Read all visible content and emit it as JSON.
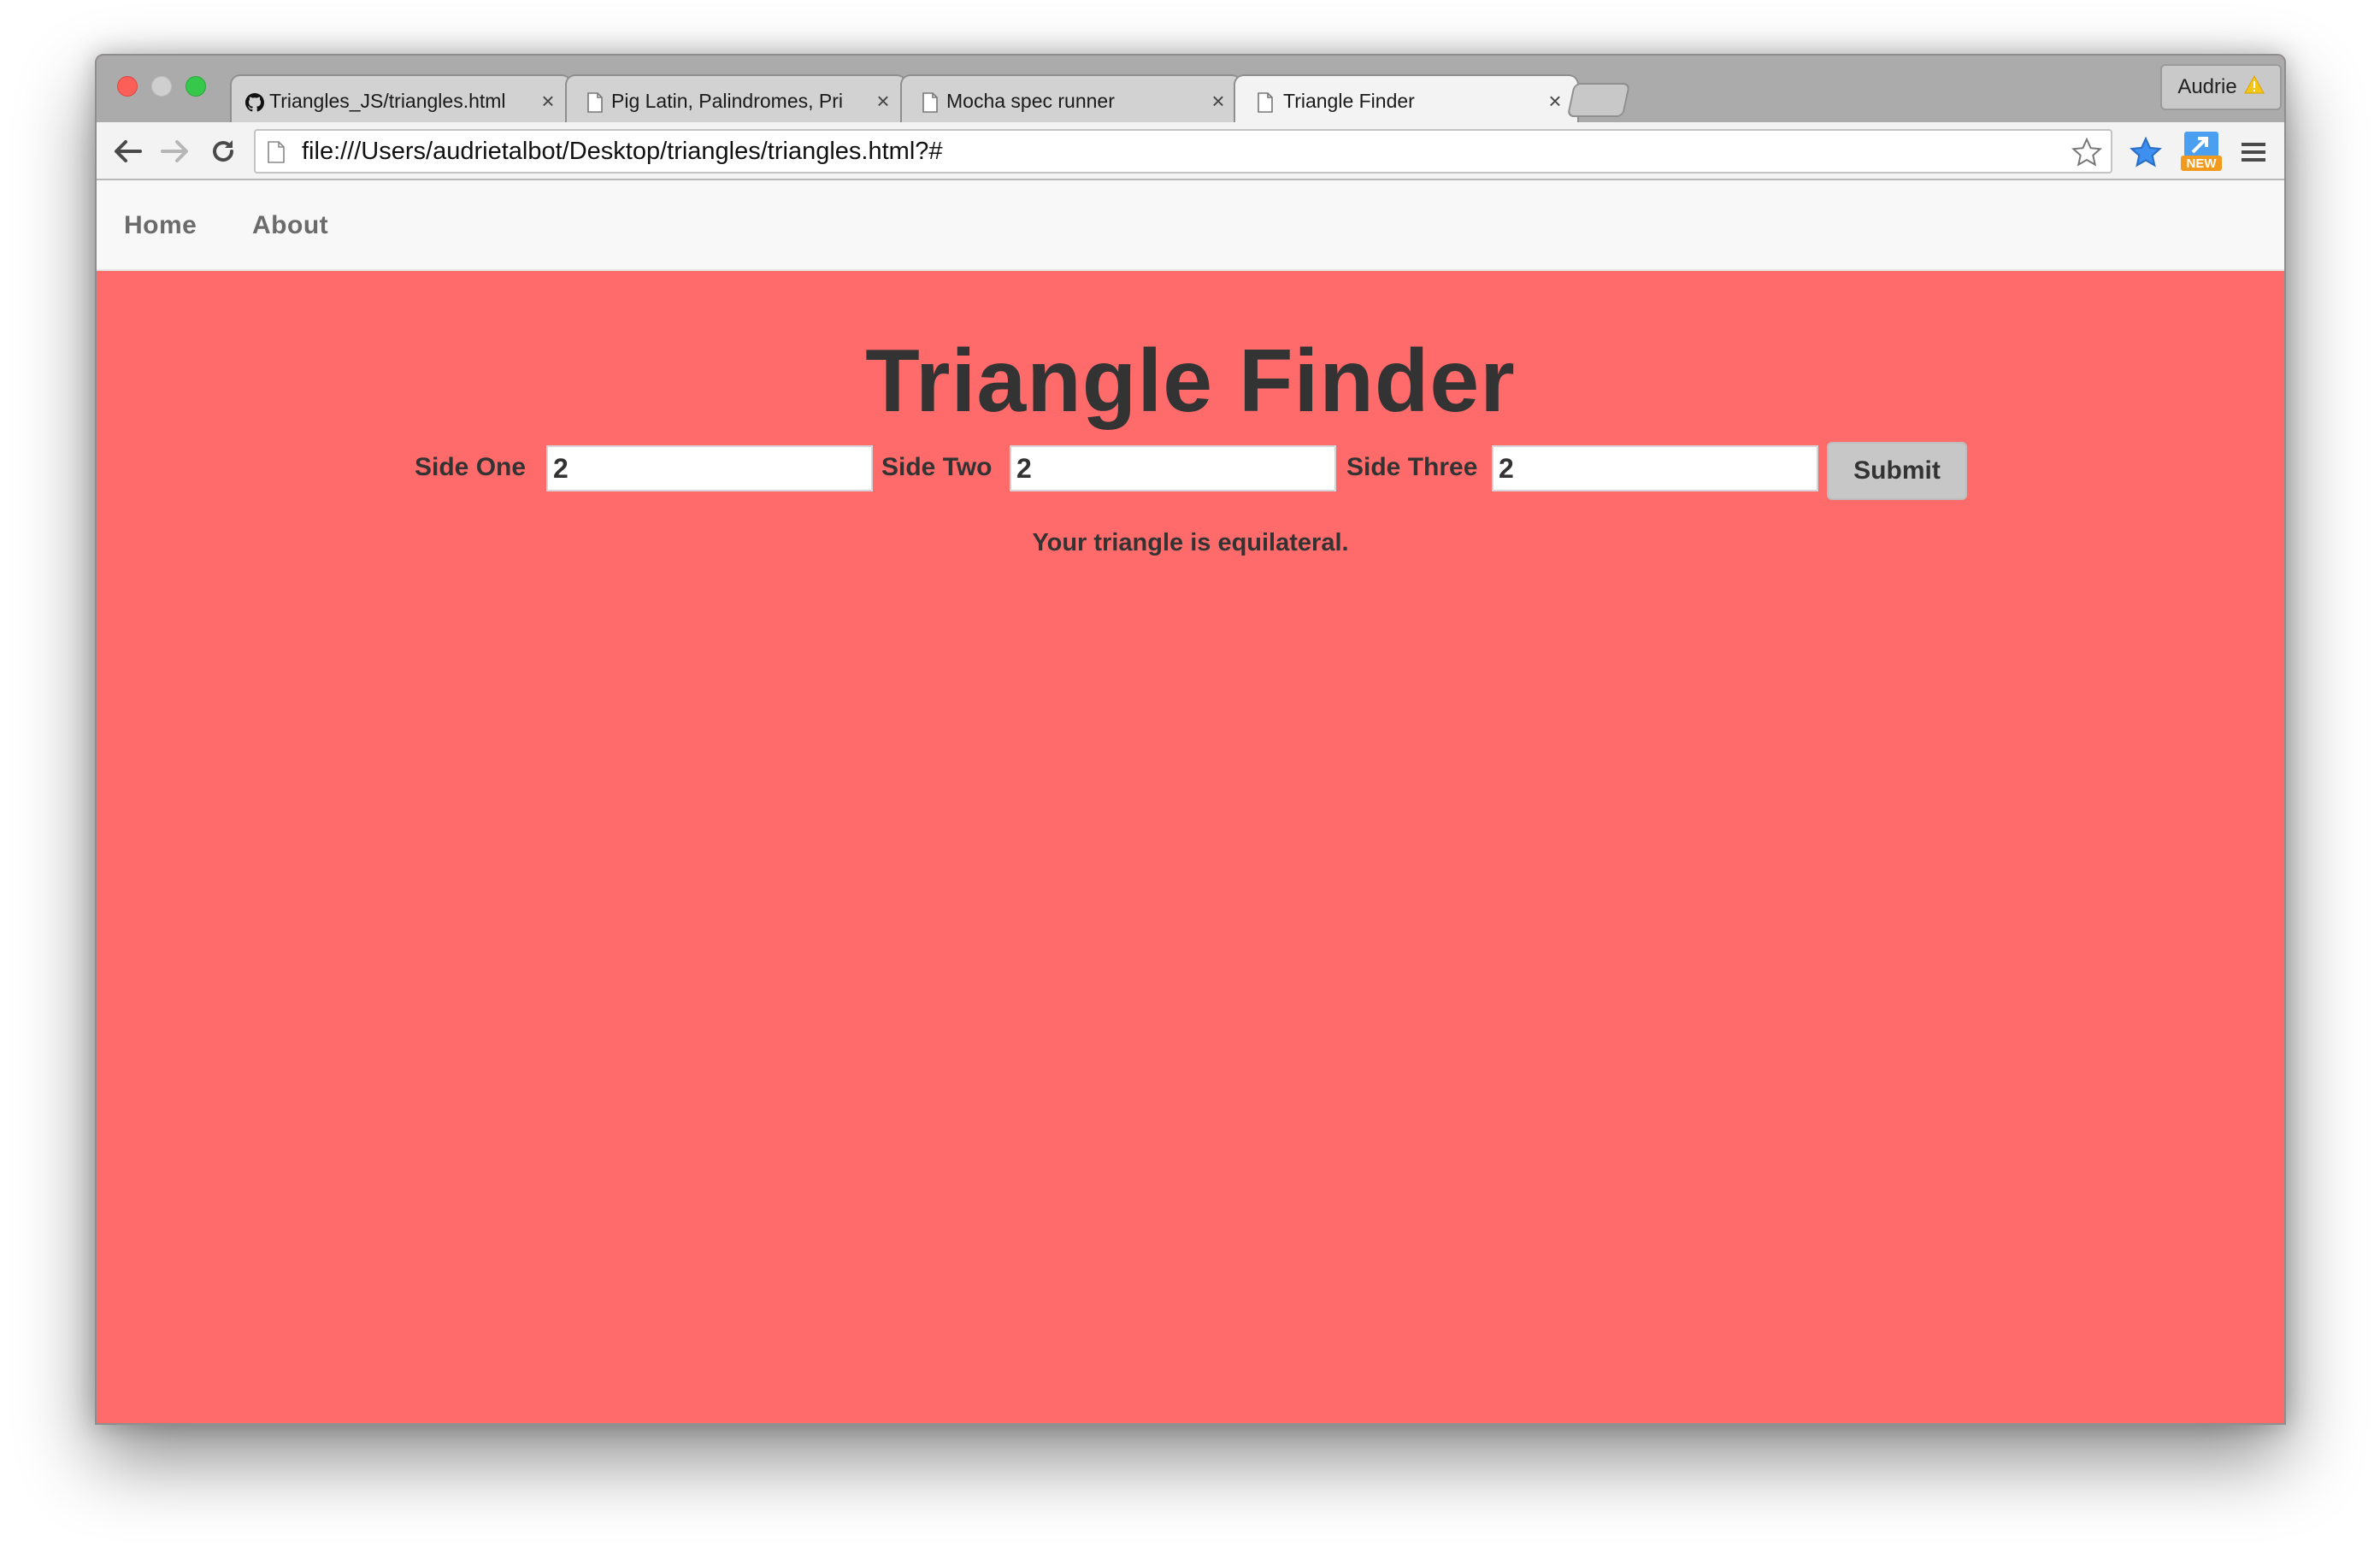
{
  "browser": {
    "tabs": [
      {
        "title": "Triangles_JS/triangles.html",
        "icon": "github-icon"
      },
      {
        "title": "Pig Latin, Palindromes, Pri",
        "icon": "page-icon"
      },
      {
        "title": "Mocha spec runner",
        "icon": "page-icon"
      },
      {
        "title": "Triangle Finder",
        "icon": "page-icon"
      }
    ],
    "close_glyph": "×",
    "profile_name": "Audrie",
    "url": "file:///Users/audrietalbot/Desktop/triangles/triangles.html?#",
    "extension_badge": "NEW"
  },
  "nav": {
    "home": "Home",
    "about": "About"
  },
  "page": {
    "title": "Triangle Finder",
    "side_one_label": "Side One",
    "side_two_label": "Side Two",
    "side_three_label": "Side Three",
    "side_one_value": "2",
    "side_two_value": "2",
    "side_three_value": "2",
    "submit_label": "Submit",
    "result": "Your triangle is equilateral."
  },
  "colors": {
    "page_background": "#ff6b6b",
    "navbar_background": "#f8f8f8",
    "text": "#333333"
  }
}
